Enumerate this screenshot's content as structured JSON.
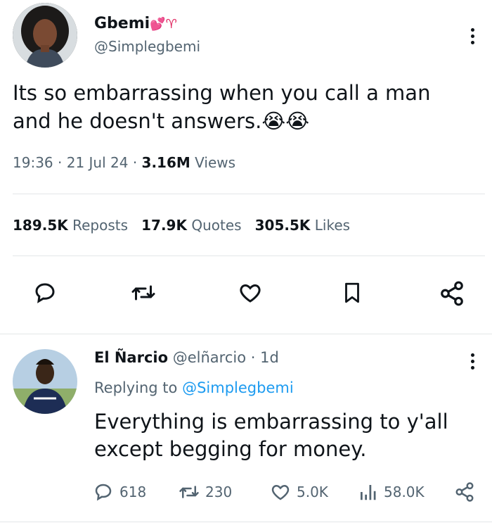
{
  "tweet": {
    "display_name": "Gbemi",
    "name_emojis": "💕♈",
    "handle": "@Simplegbemi",
    "text": "Its so embarrassing when you call a man and he doesn't answers.😭😭",
    "time": "19:36",
    "date": "21 Jul 24",
    "views_count": "3.16M",
    "views_label": "Views",
    "reposts_count": "189.5K",
    "reposts_label": "Reposts",
    "quotes_count": "17.9K",
    "quotes_label": "Quotes",
    "likes_count": "305.5K",
    "likes_label": "Likes",
    "sep": "·"
  },
  "reply": {
    "display_name": "El Ñarcio",
    "handle": "@elñarcio",
    "age": "· 1d",
    "replying_prefix": "Replying to",
    "replying_handle": "@Simplegbemi",
    "text": "Everything is embarrassing to y'all except begging for money.",
    "replies": "618",
    "reposts": "230",
    "likes": "5.0K",
    "views": "58.0K"
  },
  "icons": {
    "reply": "reply-icon",
    "repost": "repost-icon",
    "like": "heart-icon",
    "bookmark": "bookmark-icon",
    "share": "share-icon",
    "views": "views-icon",
    "more": "more-icon"
  },
  "colors": {
    "text": "#0f1419",
    "secondary": "#536471",
    "accent": "#1d9bf0",
    "divider": "#e3e6e8"
  }
}
